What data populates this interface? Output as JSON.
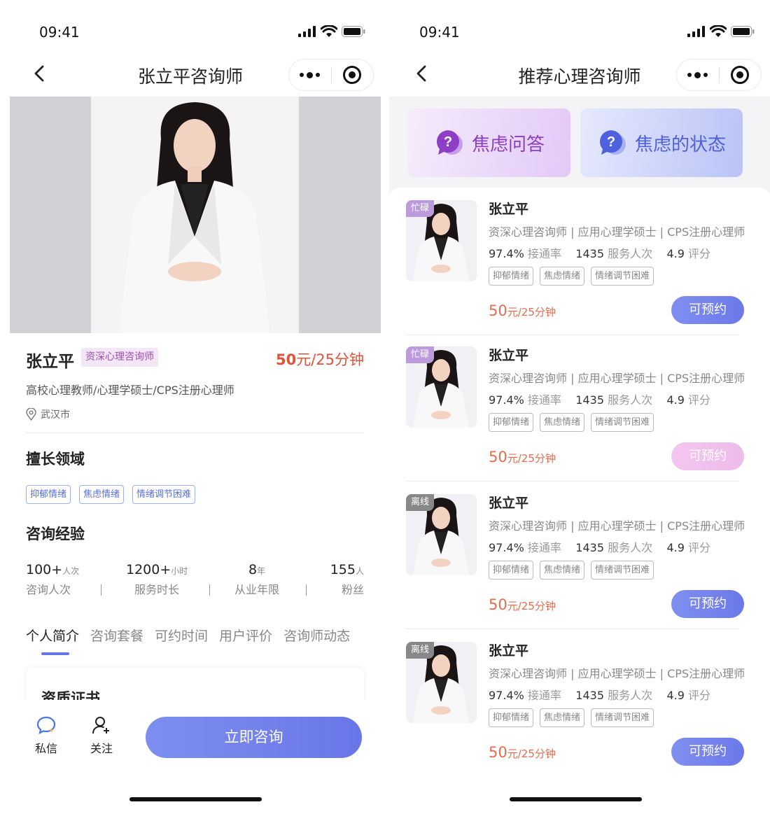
{
  "left": {
    "status_time": "09:41",
    "nav_title": "张立平咨询师",
    "name": "张立平",
    "senior_tag": "资深心理咨询师",
    "price_amount": "50",
    "price_unit": "元/25分钟",
    "subtitle": "高校心理教师/心理学硕士/CPS注册心理师",
    "location": "武汉市",
    "expertise_title": "擅长领域",
    "expertise_tags": [
      "抑郁情绪",
      "焦虑情绪",
      "情绪调节困难"
    ],
    "experience_title": "咨询经验",
    "stats": [
      {
        "num": "100+",
        "unit": "人次",
        "label": "咨询人次"
      },
      {
        "num": "1200+",
        "unit": "小时",
        "label": "服务时长"
      },
      {
        "num": "8",
        "unit": "年",
        "label": "从业年限"
      },
      {
        "num": "155",
        "unit": "人",
        "label": "粉丝"
      }
    ],
    "stat_sep": "|",
    "tabs": [
      "个人简介",
      "咨询套餐",
      "可约时间",
      "用户评价",
      "咨询师动态"
    ],
    "cert_title": "资质证书",
    "bottom": {
      "message": "私信",
      "follow": "关注",
      "cta": "立即咨询"
    }
  },
  "right": {
    "status_time": "09:41",
    "nav_title": "推荐心理咨询师",
    "banners": [
      "焦虑问答",
      "焦虑的状态"
    ],
    "banner_q": "?",
    "cards": [
      {
        "status": "忙碌",
        "name": "张立平",
        "title": "资深心理咨询师 | 应用心理学硕士 | CPS注册心理师",
        "rate": "97.4%",
        "rate_label": "接通率",
        "served": "1435",
        "served_label": "服务人次",
        "score": "4.9",
        "score_label": "评分",
        "tags": [
          "抑郁情绪",
          "焦虑情绪",
          "情绪调节困难"
        ],
        "price_amount": "50",
        "price_unit": "元/25分钟",
        "button": "可预约"
      },
      {
        "status": "忙碌",
        "name": "张立平",
        "title": "资深心理咨询师 | 应用心理学硕士 | CPS注册心理师",
        "rate": "97.4%",
        "rate_label": "接通率",
        "served": "1435",
        "served_label": "服务人次",
        "score": "4.9",
        "score_label": "评分",
        "tags": [
          "抑郁情绪",
          "焦虑情绪",
          "情绪调节困难"
        ],
        "price_amount": "50",
        "price_unit": "元/25分钟",
        "button": "可预约"
      },
      {
        "status": "离线",
        "name": "张立平",
        "title": "资深心理咨询师 | 应用心理学硕士 | CPS注册心理师",
        "rate": "97.4%",
        "rate_label": "接通率",
        "served": "1435",
        "served_label": "服务人次",
        "score": "4.9",
        "score_label": "评分",
        "tags": [
          "抑郁情绪",
          "焦虑情绪",
          "情绪调节困难"
        ],
        "price_amount": "50",
        "price_unit": "元/25分钟",
        "button": "可预约"
      },
      {
        "status": "离线",
        "name": "张立平",
        "title": "资深心理咨询师 | 应用心理学硕士 | CPS注册心理师",
        "rate": "97.4%",
        "rate_label": "接通率",
        "served": "1435",
        "served_label": "服务人次",
        "score": "4.9",
        "score_label": "评分",
        "tags": [
          "抑郁情绪",
          "焦虑情绪",
          "情绪调节困难"
        ],
        "price_amount": "50",
        "price_unit": "元/25分钟",
        "button": "可预约"
      }
    ]
  },
  "colors": {
    "accent": "#6a76e8",
    "price": "#e0523a",
    "busy_badge": "#bb9bdb",
    "offline_badge": "#888888",
    "disabled_button": "#f0c0ec"
  },
  "icons": [
    "back-arrow-icon",
    "more-dots-icon",
    "target-circle-icon",
    "signal-icon",
    "wifi-icon",
    "battery-icon",
    "location-pin-icon",
    "chat-bubble-icon",
    "add-user-icon",
    "question-bubble-icon"
  ]
}
